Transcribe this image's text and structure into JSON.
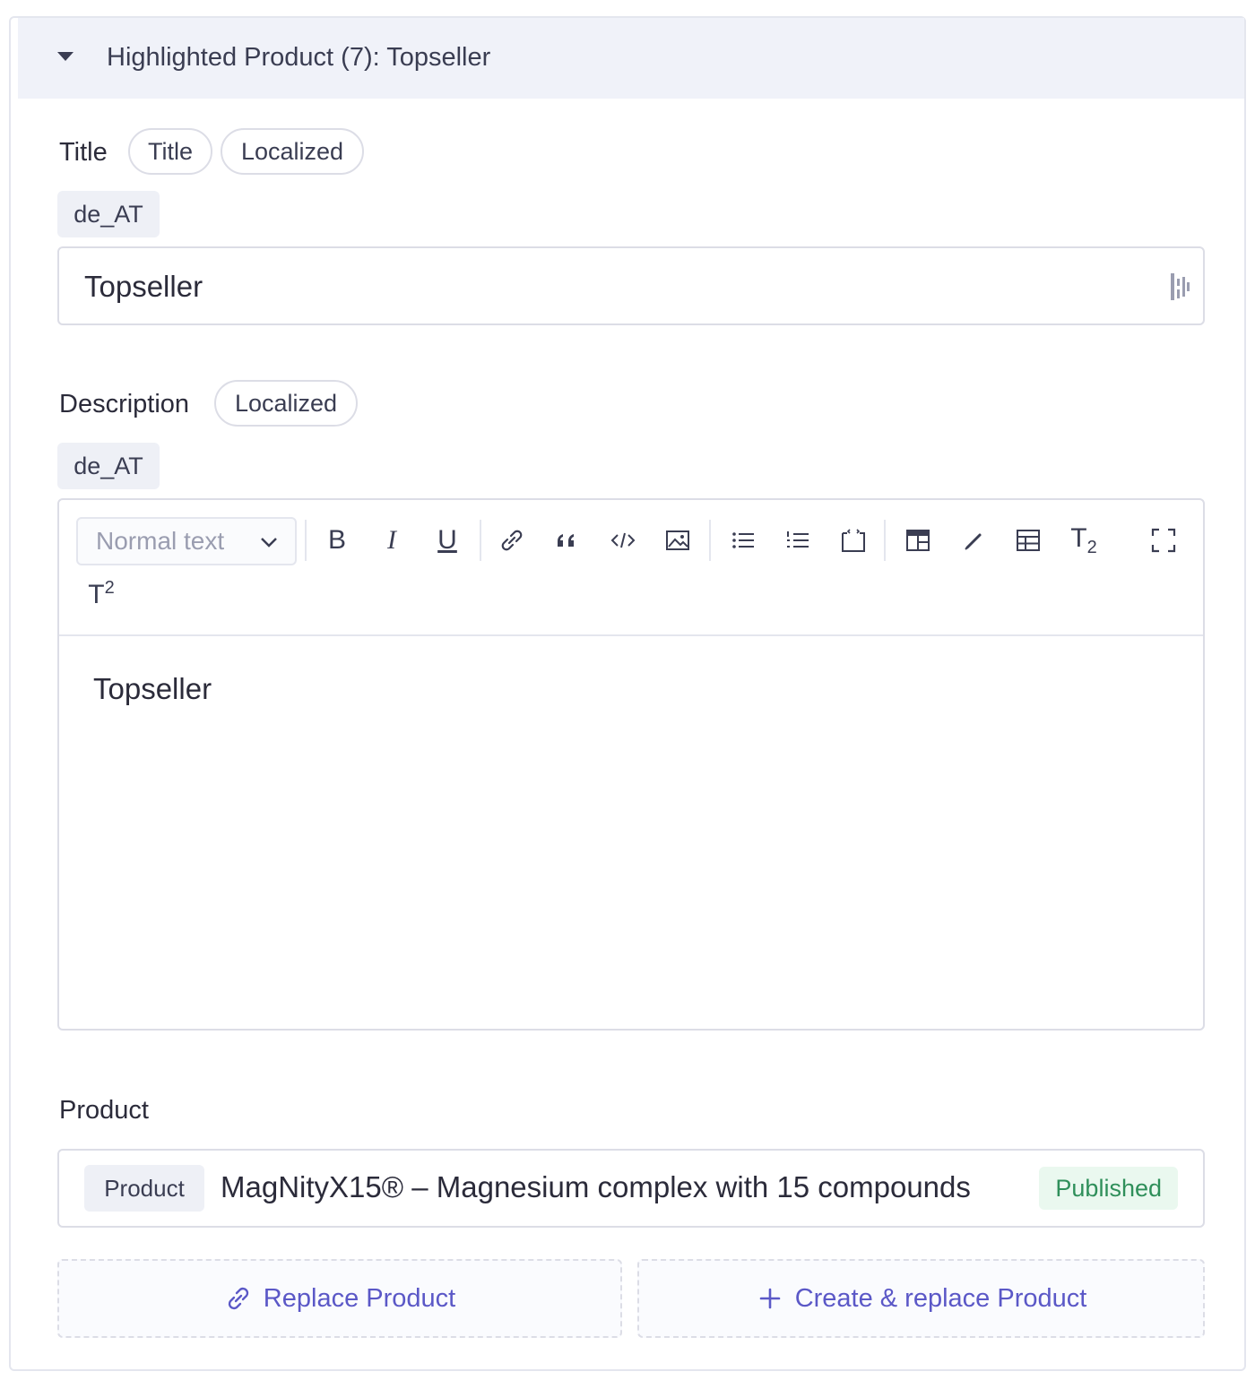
{
  "panel": {
    "title": "Highlighted Product (7): Topseller"
  },
  "title_field": {
    "label": "Title",
    "tags": [
      "Title",
      "Localized"
    ],
    "locale": "de_AT",
    "value": "Topseller"
  },
  "description_field": {
    "label": "Description",
    "tags": [
      "Localized"
    ],
    "locale": "de_AT",
    "format_select": "Normal text",
    "toolbar_text": {
      "bold": "B",
      "italic": "I",
      "underline": "U",
      "subscript_base": "T",
      "subscript": "2",
      "superscript_base": "T",
      "superscript": "2"
    },
    "content": "Topseller"
  },
  "product_field": {
    "label": "Product",
    "type_tag": "Product",
    "name": "MagNityX15® – Magnesium complex with 15 compounds",
    "status": "Published"
  },
  "actions": {
    "replace": "Replace Product",
    "create_replace": "Create & replace Product"
  },
  "colors": {
    "accent": "#5b58c7",
    "status_published": "#2f8f5a",
    "header_bg": "#f0f2f9",
    "border": "#dcdde6"
  }
}
